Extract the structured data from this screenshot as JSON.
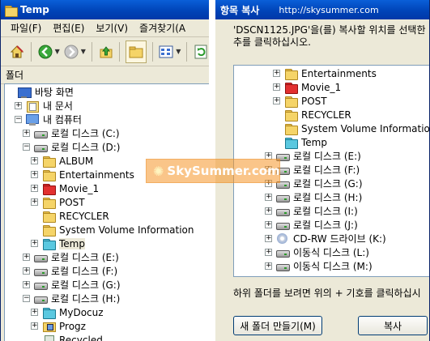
{
  "explorer": {
    "title": "Temp",
    "menu": [
      "파일(F)",
      "편집(E)",
      "보기(V)",
      "즐겨찾기(A"
    ],
    "folder_pane_label": "폴더",
    "tree": [
      {
        "label": "바탕 화면",
        "icon": "desktop-icon",
        "indent": 0,
        "expander": "none"
      },
      {
        "label": "내 문서",
        "icon": "my-documents-icon",
        "indent": 1,
        "expander": "+"
      },
      {
        "label": "내 컴퓨터",
        "icon": "my-computer-icon",
        "indent": 1,
        "expander": "-"
      },
      {
        "label": "로컬 디스크 (C:)",
        "icon": "drive-icon",
        "indent": 2,
        "expander": "+"
      },
      {
        "label": "로컬 디스크 (D:)",
        "icon": "drive-icon",
        "indent": 2,
        "expander": "-"
      },
      {
        "label": "ALBUM",
        "icon": "folder-icon",
        "indent": 3,
        "expander": "+"
      },
      {
        "label": "Entertainments",
        "icon": "folder-icon",
        "indent": 3,
        "expander": "+"
      },
      {
        "label": "Movie_1",
        "icon": "red-folder-icon",
        "indent": 3,
        "expander": "+"
      },
      {
        "label": "POST",
        "icon": "folder-icon",
        "indent": 3,
        "expander": "+"
      },
      {
        "label": "RECYCLER",
        "icon": "folder-icon",
        "indent": 3,
        "expander": "none"
      },
      {
        "label": "System Volume Information",
        "icon": "folder-icon",
        "indent": 3,
        "expander": "none"
      },
      {
        "label": "Temp",
        "icon": "cyan-folder-icon",
        "indent": 3,
        "expander": "+",
        "selected": true
      },
      {
        "label": "로컬 디스크 (E:)",
        "icon": "drive-icon",
        "indent": 2,
        "expander": "+"
      },
      {
        "label": "로컬 디스크 (F:)",
        "icon": "drive-icon",
        "indent": 2,
        "expander": "+"
      },
      {
        "label": "로컬 디스크 (G:)",
        "icon": "drive-icon",
        "indent": 2,
        "expander": "+"
      },
      {
        "label": "로컬 디스크 (H:)",
        "icon": "drive-icon",
        "indent": 2,
        "expander": "-"
      },
      {
        "label": "MyDocuz",
        "icon": "cyan-folder-icon",
        "indent": 3,
        "expander": "+"
      },
      {
        "label": "Progz",
        "icon": "programs-folder-icon",
        "indent": 3,
        "expander": "+"
      },
      {
        "label": "Recycled",
        "icon": "recycle-bin-icon",
        "indent": 3,
        "expander": "none"
      }
    ]
  },
  "dialog": {
    "title": "항목 복사",
    "url": "http://skysummer.com",
    "instruction": "'DSCN1125.JPG'을(를) 복사할 위치를 선택한\n추를 클릭하십시오.",
    "tree": [
      {
        "label": "Entertainments",
        "icon": "folder-icon",
        "indent": 3,
        "expander": "+"
      },
      {
        "label": "Movie_1",
        "icon": "red-folder-icon",
        "indent": 3,
        "expander": "+"
      },
      {
        "label": "POST",
        "icon": "folder-icon",
        "indent": 3,
        "expander": "+"
      },
      {
        "label": "RECYCLER",
        "icon": "folder-icon",
        "indent": 3,
        "expander": "none"
      },
      {
        "label": "System Volume Information",
        "icon": "folder-icon",
        "indent": 3,
        "expander": "none"
      },
      {
        "label": "Temp",
        "icon": "cyan-folder-icon",
        "indent": 3,
        "expander": "none"
      },
      {
        "label": "로컬 디스크 (E:)",
        "icon": "drive-icon",
        "indent": 2,
        "expander": "+"
      },
      {
        "label": "로컬 디스크 (F:)",
        "icon": "drive-icon",
        "indent": 2,
        "expander": "+"
      },
      {
        "label": "로컬 디스크 (G:)",
        "icon": "drive-icon",
        "indent": 2,
        "expander": "+"
      },
      {
        "label": "로컬 디스크 (H:)",
        "icon": "drive-icon",
        "indent": 2,
        "expander": "+"
      },
      {
        "label": "로컬 디스크 (I:)",
        "icon": "drive-icon",
        "indent": 2,
        "expander": "+"
      },
      {
        "label": "로컬 디스크 (J:)",
        "icon": "drive-icon",
        "indent": 2,
        "expander": "+"
      },
      {
        "label": "CD-RW 드라이브 (K:)",
        "icon": "cd-drive-icon",
        "indent": 2,
        "expander": "+"
      },
      {
        "label": "이동식 디스크 (L:)",
        "icon": "drive-icon",
        "indent": 2,
        "expander": "+"
      },
      {
        "label": "이동식 디스크 (M:)",
        "icon": "drive-icon",
        "indent": 2,
        "expander": "+"
      }
    ],
    "hint": "하위 폴더를 보려면 위의 + 기호를 클릭하십시",
    "new_folder_button": "새 폴더 만들기(M)",
    "copy_button": "복사"
  },
  "watermark": {
    "text": "SkySummer.com"
  },
  "colors": {
    "titlebar": "#0a5fd8",
    "window_bg": "#ece9d8",
    "selection": "#ece9d8",
    "watermark": "#f59628"
  }
}
